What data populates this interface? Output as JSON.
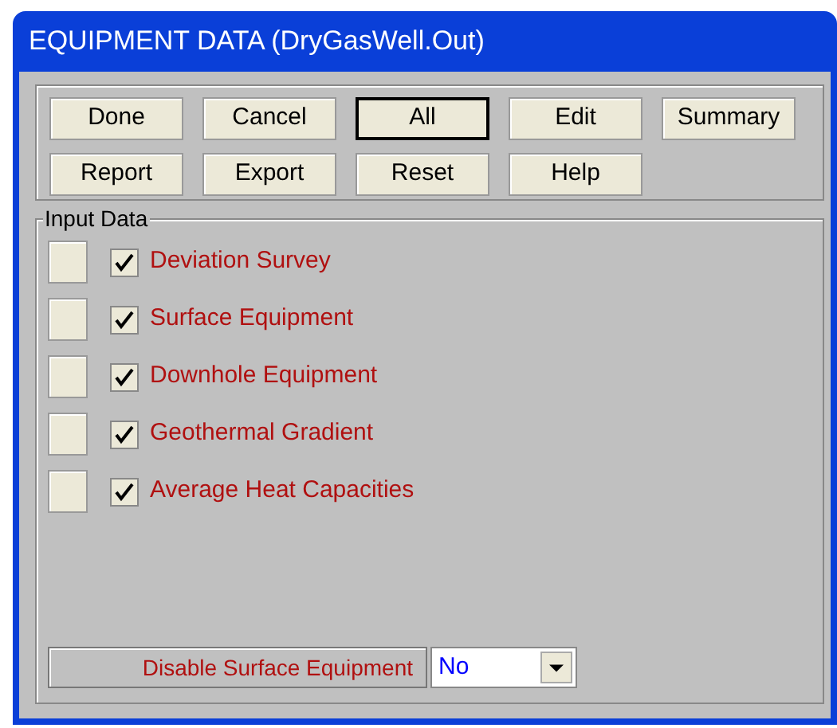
{
  "window": {
    "title": "EQUIPMENT DATA (DryGasWell.Out)"
  },
  "buttons": [
    {
      "label": "Done",
      "selected": false
    },
    {
      "label": "Cancel",
      "selected": false
    },
    {
      "label": "All",
      "selected": true
    },
    {
      "label": "Edit",
      "selected": false
    },
    {
      "label": "Summary",
      "selected": false
    },
    {
      "label": "Report",
      "selected": false
    },
    {
      "label": "Export",
      "selected": false
    },
    {
      "label": "Reset",
      "selected": false
    },
    {
      "label": "Help",
      "selected": false
    }
  ],
  "input_data": {
    "title": "Input Data",
    "items": [
      {
        "label": "Deviation Survey",
        "checked": true
      },
      {
        "label": "Surface Equipment",
        "checked": true
      },
      {
        "label": "Downhole Equipment",
        "checked": true
      },
      {
        "label": "Geothermal Gradient",
        "checked": true
      },
      {
        "label": "Average Heat Capacities",
        "checked": true
      }
    ]
  },
  "disable_surface_equipment": {
    "label": "Disable Surface Equipment",
    "value": "No"
  }
}
